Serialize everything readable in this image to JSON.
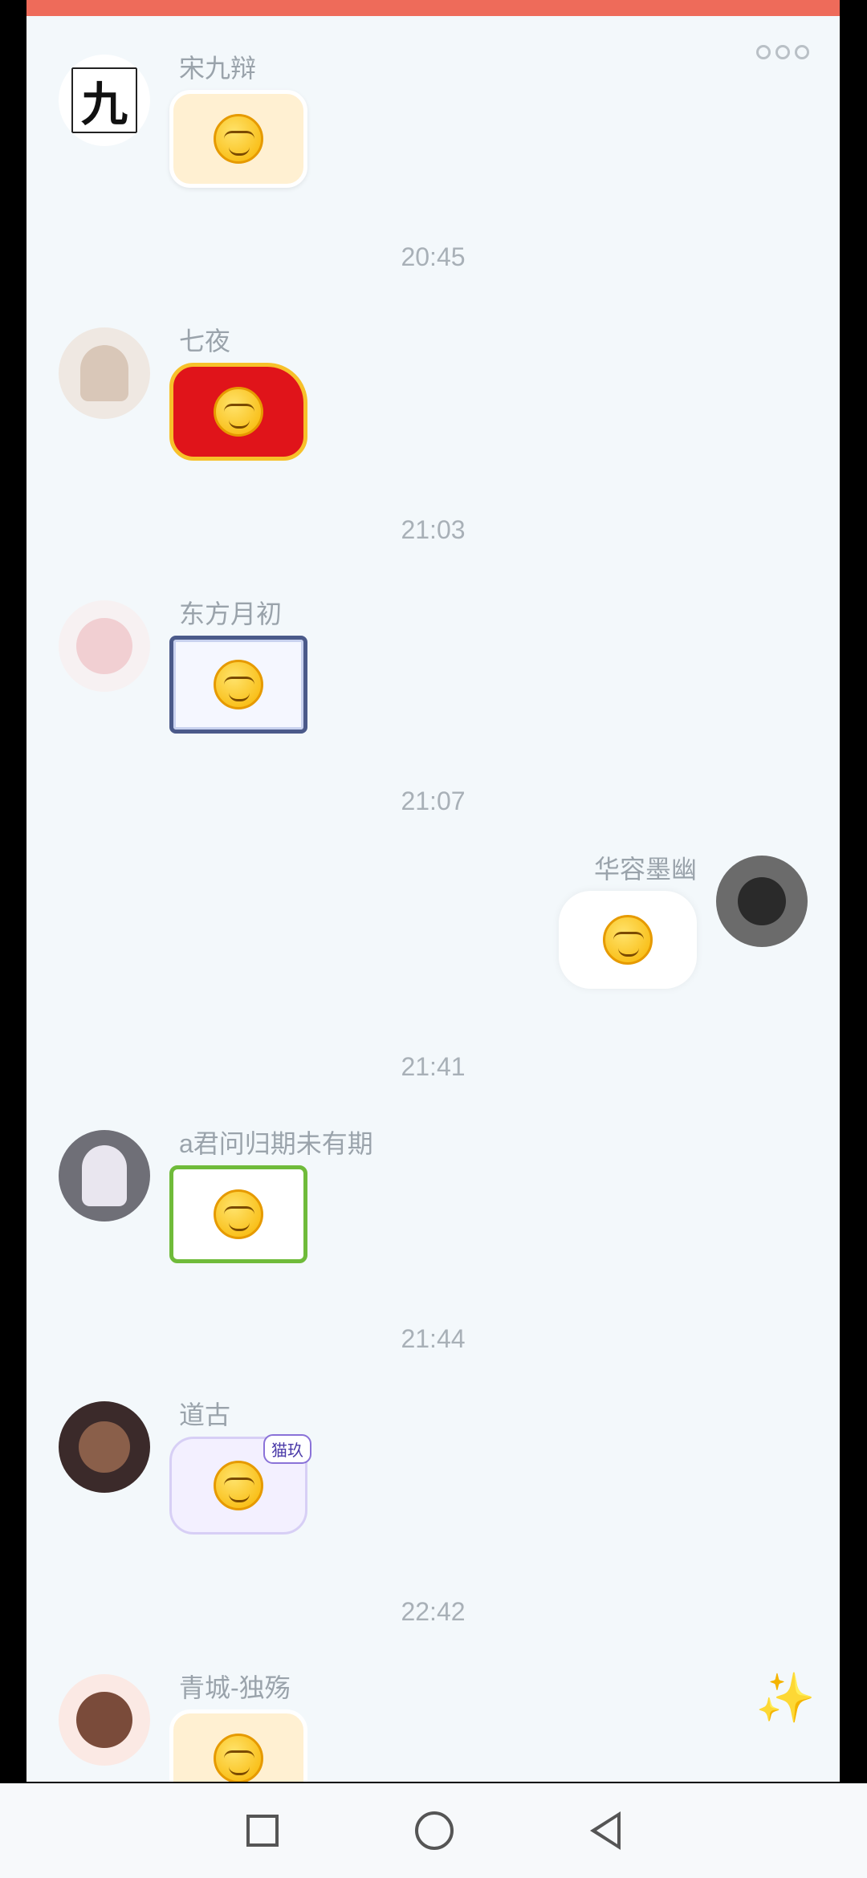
{
  "more_icon": "more-icon",
  "messages": [
    {
      "sender": "宋九辩",
      "avatar_text": "九",
      "self": false
    },
    {
      "time": "20:45"
    },
    {
      "sender": "七夜",
      "self": false
    },
    {
      "time": "21:03"
    },
    {
      "sender": "东方月初",
      "self": false
    },
    {
      "time": "21:07"
    },
    {
      "sender": "华容墨幽",
      "self": true
    },
    {
      "time": "21:41"
    },
    {
      "sender": "a君问归期未有期",
      "self": false
    },
    {
      "time": "21:44"
    },
    {
      "sender": "道古",
      "tag": "猫玖",
      "self": false
    },
    {
      "time": "22:42"
    },
    {
      "sender": "青城-独殇",
      "self": false
    }
  ],
  "nav": {
    "recent": "square",
    "home": "circle",
    "back": "triangle"
  }
}
